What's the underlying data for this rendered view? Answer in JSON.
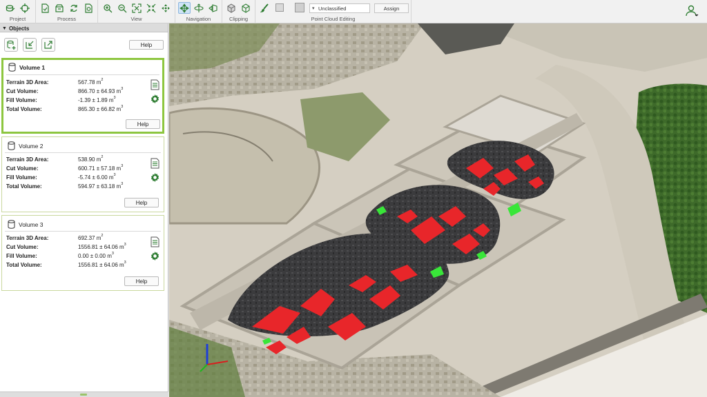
{
  "toolbar": {
    "groups": [
      {
        "label": "Project",
        "icons": [
          "open-project-icon",
          "target-icon"
        ]
      },
      {
        "label": "Process",
        "icons": [
          "document-check-icon",
          "package-icon",
          "sync-icon",
          "refresh-doc-icon"
        ]
      },
      {
        "label": "View",
        "icons": [
          "zoom-in-icon",
          "zoom-out-icon",
          "fit-view-icon",
          "collapse-icon",
          "center-icon"
        ]
      },
      {
        "label": "Navigation",
        "icons": [
          "move-arrows-icon",
          "orbit-icon",
          "pan-view-icon"
        ]
      },
      {
        "label": "Clipping",
        "icons": [
          "clip-box-icon",
          "cube-icon"
        ]
      },
      {
        "label": "Point Cloud Editing",
        "icons": [
          "brush-icon",
          "clear-selection-icon",
          "box-select-icon"
        ]
      }
    ],
    "class_select": "Unclassified",
    "assign_label": "Assign"
  },
  "panel": {
    "title": "Objects",
    "help_label": "Help",
    "volumes": [
      {
        "name": "Volume 1",
        "terrain_label": "Terrain 3D Area:",
        "terrain_value": "567.78 m",
        "cut_label": "Cut Volume:",
        "cut_value": "866.70 ± 64.93 m",
        "fill_label": "Fill Volume:",
        "fill_value": "-1.39 ± 1.89 m",
        "total_label": "Total Volume:",
        "total_value": "865.30 ± 66.82 m",
        "help_label": "Help"
      },
      {
        "name": "Volume 2",
        "terrain_label": "Terrain 3D Area:",
        "terrain_value": "538.90 m",
        "cut_label": "Cut Volume:",
        "cut_value": "600.71 ± 57.18 m",
        "fill_label": "Fill Volume:",
        "fill_value": "-5.74 ± 6.00 m",
        "total_label": "Total Volume:",
        "total_value": "594.97 ± 63.18 m",
        "help_label": "Help"
      },
      {
        "name": "Volume 3",
        "terrain_label": "Terrain 3D Area:",
        "terrain_value": "692.37 m",
        "cut_label": "Cut Volume:",
        "cut_value": "1556.81 ± 64.06 m",
        "fill_label": "Fill Volume:",
        "fill_value": "0.00 ± 0.00 m",
        "total_label": "Total Volume:",
        "total_value": "1556.81 ± 64.06 m",
        "help_label": "Help"
      }
    ],
    "area_unit_exp": "2",
    "volume_unit_exp": "3"
  },
  "colors": {
    "accent_green": "#8dc63f",
    "toolbar_icon": "#2e7d32",
    "cut_red": "#e8262a",
    "fill_green": "#39e639"
  }
}
